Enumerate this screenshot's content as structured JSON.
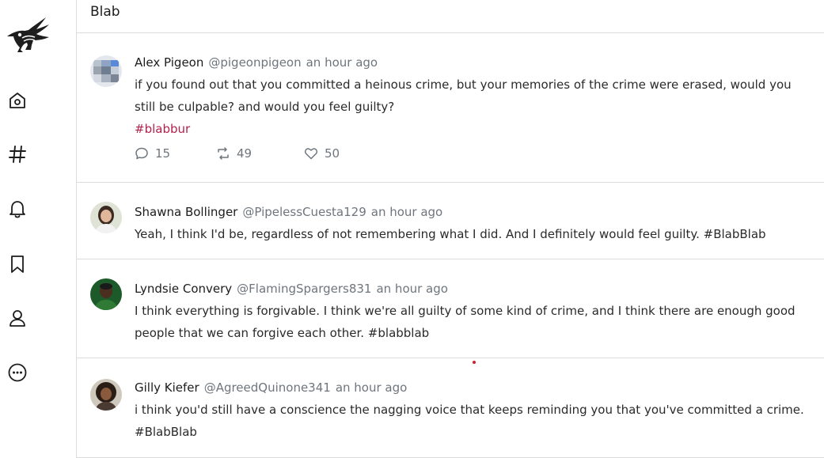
{
  "app": {
    "title": "Blab",
    "logo_icon": "crow-logo-icon",
    "colors": {
      "hashtag": "#b3214b",
      "muted": "#6e757c",
      "border": "#dcdcdc"
    }
  },
  "sidebar": {
    "items": [
      {
        "icon": "home-icon",
        "name": "nav-home"
      },
      {
        "icon": "hashtag-icon",
        "name": "nav-explore"
      },
      {
        "icon": "bell-icon",
        "name": "nav-notifications"
      },
      {
        "icon": "bookmark-icon",
        "name": "nav-bookmarks"
      },
      {
        "icon": "user-icon",
        "name": "nav-profile"
      },
      {
        "icon": "more-icon",
        "name": "nav-more"
      }
    ]
  },
  "posts": [
    {
      "author": "Alex Pigeon",
      "handle": "@pigeonpigeon",
      "time": "an hour ago",
      "text": "if you found out that you committed a heinous crime, but your memories of the crime were erased, would you still be culpable? and would you feel guilty?",
      "hashtag": "#blabbur",
      "replies": "15",
      "reblabs": "49",
      "likes": "50"
    },
    {
      "author": "Shawna Bollinger",
      "handle": "@PipelessCuesta129",
      "time": "an hour ago",
      "text": "Yeah, I think I'd be, regardless of not remembering what I did. And I definitely would feel guilty. #BlabBlab"
    },
    {
      "author": "Lyndsie Convery",
      "handle": "@FlamingSpargers831",
      "time": "an hour ago",
      "text": "I think everything is forgivable. I think we're all guilty of some kind of crime, and I think there are enough good people that we can forgive each other. #blabblab"
    },
    {
      "author": "Gilly Kiefer",
      "handle": "@AgreedQuinone341",
      "time": "an hour ago",
      "text": "i think you'd still have a conscience the nagging voice that keeps reminding you that you've committed a crime. #BlabBlab"
    }
  ]
}
